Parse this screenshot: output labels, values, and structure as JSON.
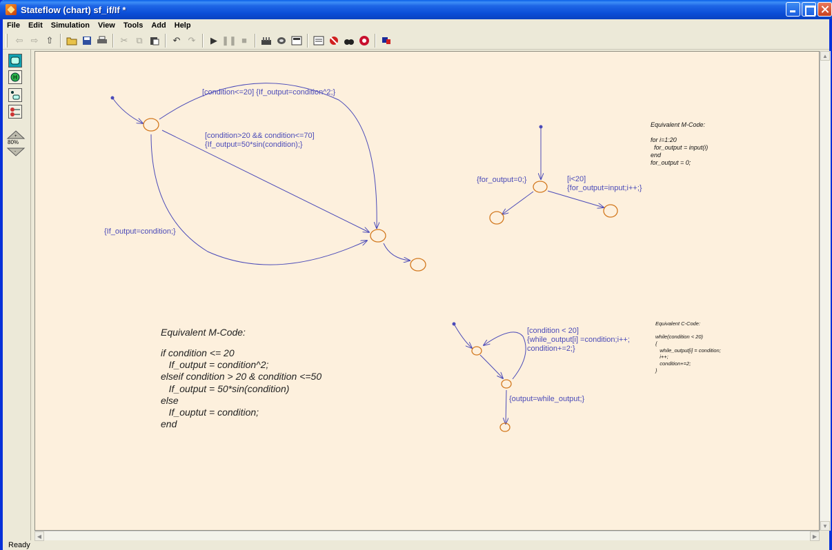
{
  "window": {
    "title": "Stateflow (chart) sf_if/If *"
  },
  "menu": {
    "items": [
      "File",
      "Edit",
      "Simulation",
      "View",
      "Tools",
      "Add",
      "Help"
    ]
  },
  "toolbar": {
    "icons": [
      "back-icon",
      "forward-icon",
      "up-icon",
      "open-icon",
      "save-icon",
      "print-icon",
      "cut-icon",
      "copy-icon",
      "paste-icon",
      "undo-icon",
      "redo-icon",
      "play-icon",
      "pause-icon",
      "stop-icon",
      "build-icon",
      "debug-icon",
      "target-icon",
      "explorer-icon",
      "breakpoint-icon",
      "find-icon",
      "stop-sign-icon",
      "simulink-icon"
    ]
  },
  "palette": {
    "zoom_label": "80%"
  },
  "chart": {
    "if_transitions": {
      "t1": "[condition<=20] {If_output=condition^2;}",
      "t2_line1": "[condition>20 && condition<=70]",
      "t2_line2": "{If_output=50*sin(condition);}",
      "t3": "{If_output=condition;}"
    },
    "for_loop": {
      "init": "{for_output=0;}",
      "cond_line1": "[i<20]",
      "cond_line2": "{for_output=input;i++;}"
    },
    "for_code": {
      "title": "Equivalent M-Code:",
      "lines": [
        "for i=1:20",
        "  for_output = input(i)",
        "end",
        "for_output = 0;"
      ]
    },
    "if_code": {
      "title": "Equivalent M-Code:",
      "lines": [
        "if condition <= 20",
        "   If_output = condition^2;",
        "elseif condition > 20 & condition <=50",
        "   If_output = 50*sin(condition)",
        "else",
        "   If_ouptut = condition;",
        "end"
      ]
    },
    "while_loop": {
      "cond_line1": "[condition < 20]",
      "cond_line2": "{while_output[i] =condition;i++;",
      "cond_line3": "condition+=2;}",
      "exit": "{output=while_output;}"
    },
    "while_code": {
      "title": "Equivalent C-Code:",
      "lines": [
        "while(condition < 20)",
        "{",
        "   while_output[i] = condition;",
        "   i++;",
        "   condition+=2;",
        "}"
      ]
    }
  },
  "status": {
    "text": "Ready"
  }
}
